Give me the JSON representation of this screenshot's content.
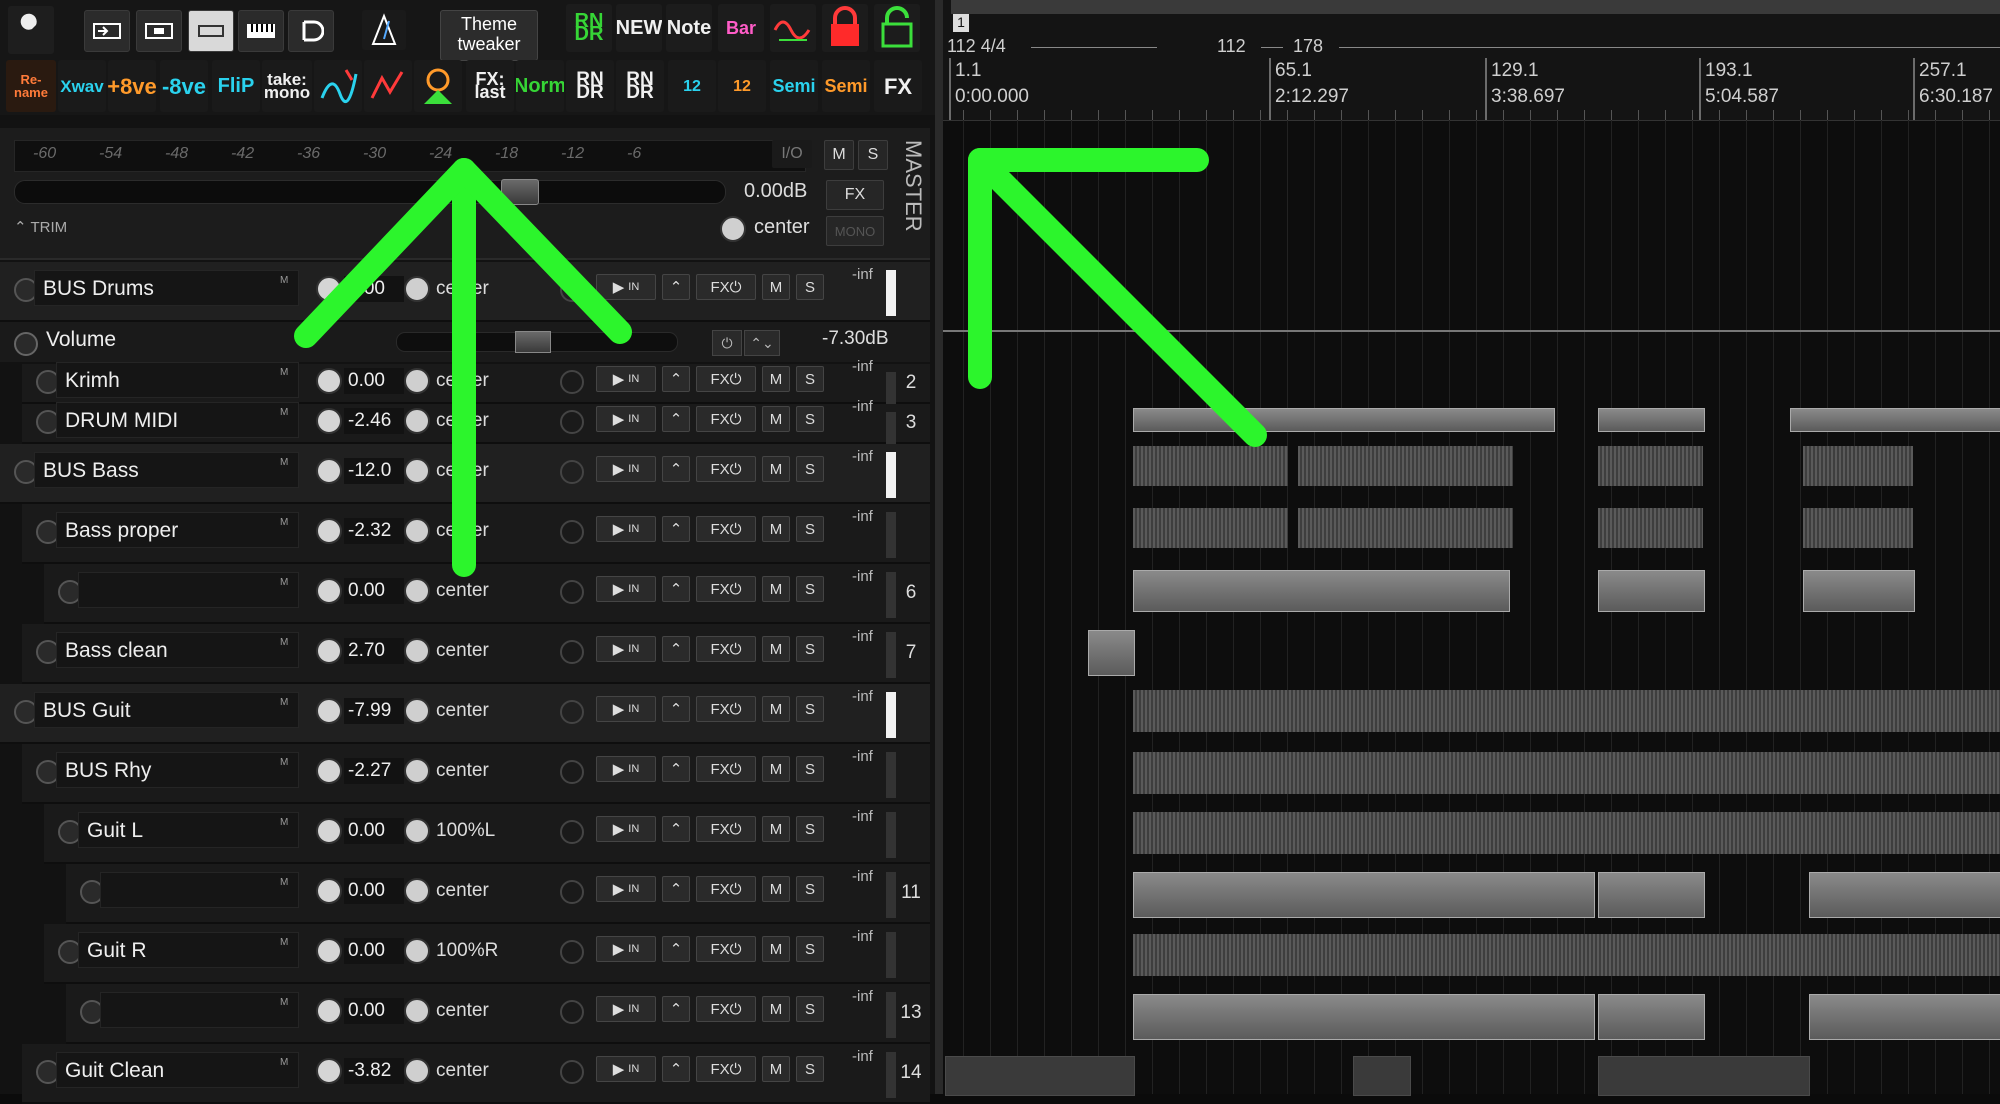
{
  "toolbar": {
    "row1": [
      {
        "id": "tools",
        "label": ""
      },
      {
        "id": "b1",
        "label": ""
      },
      {
        "id": "b2",
        "label": ""
      },
      {
        "id": "b3",
        "label": ""
      },
      {
        "id": "b4",
        "label": ""
      },
      {
        "id": "b5",
        "label": ""
      },
      {
        "id": "b6",
        "label": ""
      }
    ],
    "theme_label": "Theme\ntweaker",
    "row1_right": [
      "RN DR",
      "NEW",
      "Note",
      "Bar",
      "",
      "",
      ""
    ],
    "row2": [
      "Re-name",
      "Xwav",
      "+8ve",
      "-8ve",
      "FliP",
      "take: mono",
      "",
      "",
      "",
      "FX: last",
      "Norm",
      "RN DR",
      "RN DR",
      "12",
      "12",
      "Semi",
      "Semi",
      "FX"
    ]
  },
  "master": {
    "ticks": [
      "-60",
      "-54",
      "-48",
      "-42",
      "-36",
      "-30",
      "-24",
      "-18",
      "-12",
      "-6"
    ],
    "io_label": "I/O",
    "m_label": "M",
    "s_label": "S",
    "volume_db": "0.00dB",
    "fx_label": "FX",
    "trim_label": "TRIM",
    "pan_label": "center",
    "mono_label": "MONO",
    "title": "MASTER"
  },
  "volume_env": {
    "label": "Volume",
    "value": "-7.30dB"
  },
  "tracks": [
    {
      "name": "BUS Drums",
      "vol": "0.00",
      "pan": "center",
      "inf": "-inf",
      "num": "",
      "indent": 0
    },
    {
      "name": "Krimh",
      "vol": "0.00",
      "pan": "center",
      "inf": "-inf",
      "num": "2",
      "indent": 1
    },
    {
      "name": "DRUM MIDI",
      "vol": "-2.46",
      "pan": "center",
      "inf": "-inf",
      "num": "3",
      "indent": 1
    },
    {
      "name": "BUS Bass",
      "vol": "-12.0",
      "pan": "center",
      "inf": "-inf",
      "num": "",
      "indent": 0
    },
    {
      "name": "Bass proper",
      "vol": "-2.32",
      "pan": "center",
      "inf": "-inf",
      "num": "",
      "indent": 1
    },
    {
      "name": "",
      "vol": "0.00",
      "pan": "center",
      "inf": "-inf",
      "num": "6",
      "indent": 2
    },
    {
      "name": "Bass clean",
      "vol": "2.70",
      "pan": "center",
      "inf": "-inf",
      "num": "7",
      "indent": 1
    },
    {
      "name": "BUS Guit",
      "vol": "-7.99",
      "pan": "center",
      "inf": "-inf",
      "num": "",
      "indent": 0
    },
    {
      "name": "BUS Rhy",
      "vol": "-2.27",
      "pan": "center",
      "inf": "-inf",
      "num": "",
      "indent": 1
    },
    {
      "name": "Guit L",
      "vol": "0.00",
      "pan": "100%L",
      "inf": "-inf",
      "num": "",
      "indent": 2
    },
    {
      "name": "",
      "vol": "0.00",
      "pan": "center",
      "inf": "-inf",
      "num": "11",
      "indent": 3
    },
    {
      "name": "Guit R",
      "vol": "0.00",
      "pan": "100%R",
      "inf": "-inf",
      "num": "",
      "indent": 2
    },
    {
      "name": "",
      "vol": "0.00",
      "pan": "center",
      "inf": "-inf",
      "num": "13",
      "indent": 3
    },
    {
      "name": "Guit Clean",
      "vol": "-3.82",
      "pan": "center",
      "inf": "-inf",
      "num": "14",
      "indent": 1
    }
  ],
  "track_buttons": {
    "in": "IN",
    "fx": "FX",
    "m": "M",
    "s": "S",
    "ms": "M"
  },
  "ruler": {
    "marker_flag": "1",
    "tempo_start": "112 4/4",
    "tempo_mid": "112",
    "tempo_end": "178",
    "marks": [
      {
        "bar": "1.1",
        "time": "0:00.000"
      },
      {
        "bar": "65.1",
        "time": "2:12.297"
      },
      {
        "bar": "129.1",
        "time": "3:38.697"
      },
      {
        "bar": "193.1",
        "time": "5:04.587"
      },
      {
        "bar": "257.1",
        "time": "6:30.187"
      }
    ]
  },
  "annotation_color": "#2cf52c"
}
